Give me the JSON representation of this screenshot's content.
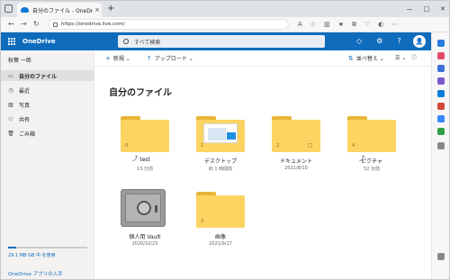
{
  "browser": {
    "tab_title": "自分のファイル - OneDrive",
    "tab_close": "×",
    "new_tab": "+",
    "url": "https://onedrive.live.com/",
    "window_controls": [
      "—",
      "□",
      "✕"
    ]
  },
  "header": {
    "app_name": "OneDrive",
    "search_placeholder": "すべて検索",
    "avatar_initial": "👤"
  },
  "sidebar": {
    "user_name": "秋葉 一郎",
    "items": [
      {
        "label": "自分のファイル",
        "icon": "folder-icon",
        "active": true
      },
      {
        "label": "最近",
        "icon": "clock-icon",
        "active": false
      },
      {
        "label": "写真",
        "icon": "photo-icon",
        "active": false
      },
      {
        "label": "共有",
        "icon": "people-icon",
        "active": false
      },
      {
        "label": "ごみ箱",
        "icon": "trash-icon",
        "active": false
      }
    ],
    "storage_text": "29.1 MB GB 中 を使用",
    "storage_fraction": 0.1,
    "buy_link": "OneDrive アプリの入手"
  },
  "commands": {
    "new_label": "新規",
    "upload_label": "アップロード",
    "sort_label": "並べ替え"
  },
  "main": {
    "title": "自分のファイル",
    "items": [
      {
        "name": "test",
        "sub": "13 分前",
        "count": "0",
        "type": "folder",
        "shared": true
      },
      {
        "name": "デスクトップ",
        "sub": "約 1 時間前",
        "count": "1",
        "type": "desktop",
        "shared": false
      },
      {
        "name": "ドキュメント",
        "sub": "2021/8/10",
        "count": "2",
        "type": "folder",
        "shared": false
      },
      {
        "name": "ピクチャ",
        "sub": "52 分前",
        "count": "4",
        "type": "folder",
        "shared": true
      },
      {
        "name": "個人用 Vault",
        "sub": "2020/10/23",
        "count": "",
        "type": "vault",
        "shared": false
      },
      {
        "name": "画像",
        "sub": "2021/9/17",
        "count": "3",
        "type": "folder",
        "shared": false
      }
    ]
  },
  "colors": {
    "brand": "#0f6cbd",
    "folder": "#fcd462"
  }
}
